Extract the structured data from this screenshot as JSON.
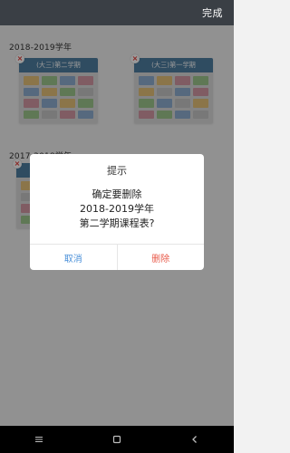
{
  "topbar": {
    "done_label": "完成"
  },
  "sections": [
    {
      "year": "2018-2019学年",
      "cards": [
        {
          "title": "(大三)第二学期"
        },
        {
          "title": "(大三)第一学期"
        }
      ]
    },
    {
      "year": "2017-2018学年",
      "cards": [
        {
          "title": ""
        }
      ]
    }
  ],
  "dialog": {
    "title": "提示",
    "message_lines": [
      "确定要删除",
      "2018-2019学年",
      "第二学期课程表?"
    ],
    "cancel_label": "取消",
    "delete_label": "删除"
  },
  "icons": {
    "delete_badge": "close-icon",
    "nav_menu": "menu-icon",
    "nav_home": "square-icon",
    "nav_back": "back-icon"
  },
  "colors": {
    "topbar": "#3a3f45",
    "card_header": "#4f7fa2",
    "cancel": "#4a90d9",
    "delete": "#e85a4a"
  }
}
